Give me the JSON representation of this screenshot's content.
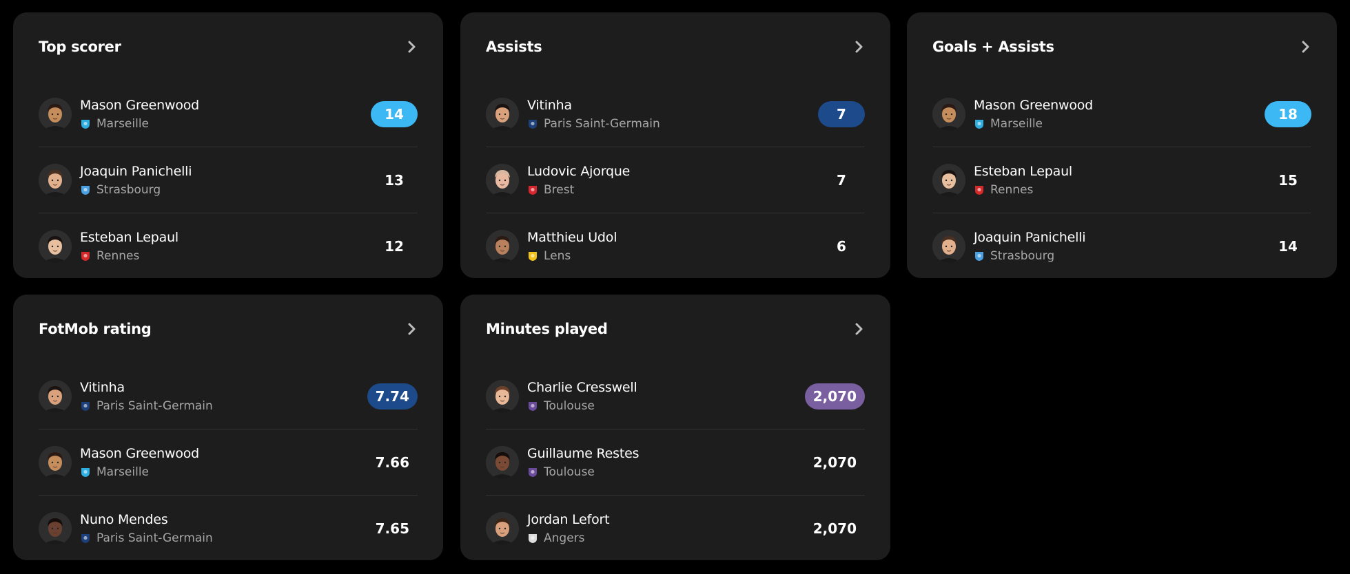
{
  "cards": [
    {
      "title": "Top scorer",
      "highlight": "#3cb8f5",
      "rows": [
        {
          "name": "Mason Greenwood",
          "team": "Marseille",
          "team_logo": "marseille",
          "value": "14",
          "skin": "#c58c5c",
          "hair": "#2a1a12"
        },
        {
          "name": "Joaquin Panichelli",
          "team": "Strasbourg",
          "team_logo": "strasbourg",
          "value": "13",
          "skin": "#e2b08c",
          "hair": "#4a3020"
        },
        {
          "name": "Esteban Lepaul",
          "team": "Rennes",
          "team_logo": "rennes",
          "value": "12",
          "skin": "#e8c0a0",
          "hair": "#1a1210"
        }
      ]
    },
    {
      "title": "Assists",
      "highlight": "#1d4a8a",
      "rows": [
        {
          "name": "Vitinha",
          "team": "Paris Saint-Germain",
          "team_logo": "psg",
          "value": "7",
          "skin": "#d9a27c",
          "hair": "#1a120e"
        },
        {
          "name": "Ludovic Ajorque",
          "team": "Brest",
          "team_logo": "brest",
          "value": "7",
          "skin": "#e8b8a0",
          "hair": "#d8b8a0"
        },
        {
          "name": "Matthieu Udol",
          "team": "Lens",
          "team_logo": "lens",
          "value": "6",
          "skin": "#b8805c",
          "hair": "#2a1a12"
        }
      ]
    },
    {
      "title": "Goals + Assists",
      "highlight": "#3cb8f5",
      "rows": [
        {
          "name": "Mason Greenwood",
          "team": "Marseille",
          "team_logo": "marseille",
          "value": "18",
          "skin": "#c58c5c",
          "hair": "#2a1a12"
        },
        {
          "name": "Esteban Lepaul",
          "team": "Rennes",
          "team_logo": "rennes",
          "value": "15",
          "skin": "#e8c0a0",
          "hair": "#1a1210"
        },
        {
          "name": "Joaquin Panichelli",
          "team": "Strasbourg",
          "team_logo": "strasbourg",
          "value": "14",
          "skin": "#e2b08c",
          "hair": "#4a3020"
        }
      ]
    },
    {
      "title": "FotMob rating",
      "highlight": "#1d4a8a",
      "rows": [
        {
          "name": "Vitinha",
          "team": "Paris Saint-Germain",
          "team_logo": "psg",
          "value": "7.74",
          "skin": "#d9a27c",
          "hair": "#1a120e"
        },
        {
          "name": "Mason Greenwood",
          "team": "Marseille",
          "team_logo": "marseille",
          "value": "7.66",
          "skin": "#c58c5c",
          "hair": "#2a1a12"
        },
        {
          "name": "Nuno Mendes",
          "team": "Paris Saint-Germain",
          "team_logo": "psg",
          "value": "7.65",
          "skin": "#6a4030",
          "hair": "#150d0a"
        }
      ]
    },
    {
      "title": "Minutes played",
      "highlight": "#7a5fa0",
      "rows": [
        {
          "name": "Charlie Cresswell",
          "team": "Toulouse",
          "team_logo": "toulouse",
          "value": "2,070",
          "skin": "#e8b898",
          "hair": "#6a4028"
        },
        {
          "name": "Guillaume Restes",
          "team": "Toulouse",
          "team_logo": "toulouse",
          "value": "2,070",
          "skin": "#7a4a34",
          "hair": "#150d0a"
        },
        {
          "name": "Jordan Lefort",
          "team": "Angers",
          "team_logo": "angers",
          "value": "2,070",
          "skin": "#d8a07c",
          "hair": "#3a2416"
        }
      ]
    }
  ],
  "team_colors": {
    "marseille": "#2faee0",
    "strasbourg": "#4aa0e0",
    "rennes": "#d62a2a",
    "psg": "#1d3f7a",
    "brest": "#d8262f",
    "lens": "#f2c21a",
    "toulouse": "#6a4a9a",
    "angers": "#dddddd"
  }
}
